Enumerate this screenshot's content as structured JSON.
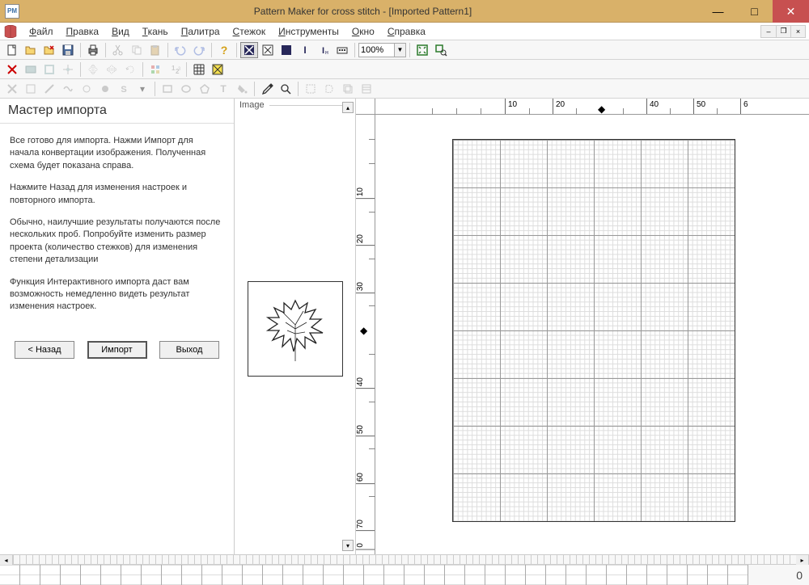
{
  "app": {
    "icon_label": "PM",
    "title": "Pattern Maker for cross stitch - [Imported Pattern1]"
  },
  "menu": {
    "items": [
      {
        "label": "Файл",
        "accel": "Ф"
      },
      {
        "label": "Правка",
        "accel": "П"
      },
      {
        "label": "Вид",
        "accel": "В"
      },
      {
        "label": "Ткань",
        "accel": "Т"
      },
      {
        "label": "Палитра",
        "accel": "П"
      },
      {
        "label": "Стежок",
        "accel": "С"
      },
      {
        "label": "Инструменты",
        "accel": "И"
      },
      {
        "label": "Окно",
        "accel": "О"
      },
      {
        "label": "Справка",
        "accel": "С"
      }
    ]
  },
  "toolbar1": {
    "zoom_value": "100%"
  },
  "wizard": {
    "title": "Мастер импорта",
    "p1": "Все готово для импорта.  Нажми Импорт для начала конвертации изображения.  Полученная схема будет показана справа.",
    "p2": "Нажмите Назад для изменения настроек и повторного импорта.",
    "p3": "Обычно, наилучшие результаты получаются после нескольких проб.  Попробуйте изменить размер проекта (количество стежков) для изменения степени детализации",
    "p4": "Функция Интерактивного импорта даст вам возможность немедленно видеть результат изменения настроек.",
    "btn_back": "< Назад",
    "btn_import": "Импорт",
    "btn_exit": "Выход"
  },
  "image_panel": {
    "title": "Image"
  },
  "ruler": {
    "h_ticks": [
      "10",
      "20",
      "40",
      "50",
      "6"
    ],
    "v_ticks": [
      "10",
      "20",
      "30",
      "40",
      "50",
      "60",
      "70",
      "0"
    ]
  },
  "palette": {
    "count": "0"
  }
}
